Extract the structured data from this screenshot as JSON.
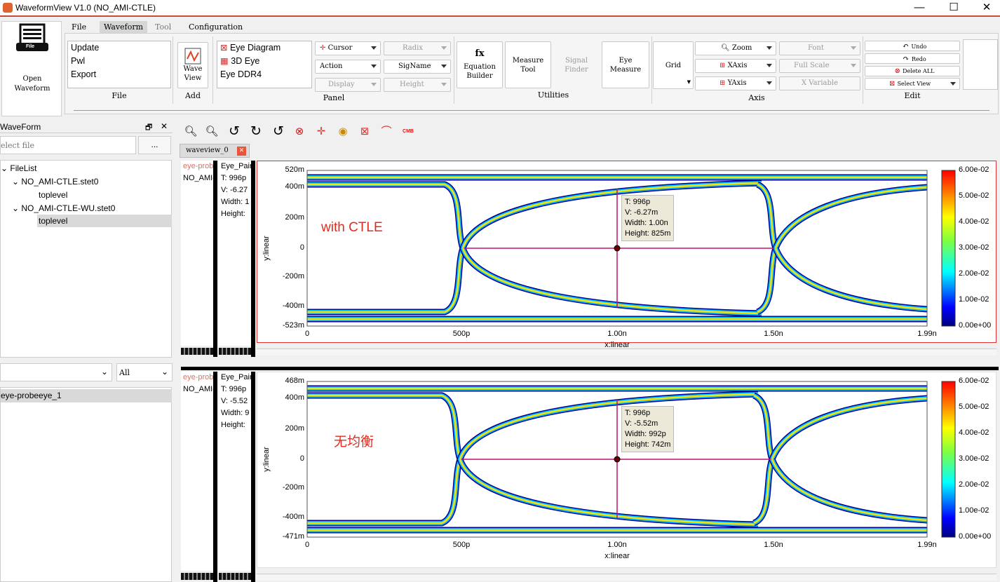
{
  "window": {
    "title": "WaveformView V1.0 (NO_AMI-CTLE)",
    "min": "—",
    "max": "☐",
    "close": "✕"
  },
  "menu": [
    "File",
    "Waveform",
    "Tool",
    "Configuration"
  ],
  "ribbon": {
    "open": {
      "icon_text": "File",
      "label1": "Open",
      "label2": "Waveform"
    },
    "file_list": [
      "Update",
      "Pwl",
      "Export"
    ],
    "file_group": "File",
    "wave_view": {
      "l1": "Wave",
      "l2": "View"
    },
    "add_group": "Add",
    "panel_list": [
      "Eye Diagram",
      "3D Eye",
      "Eye DDR4"
    ],
    "panel_group": "Panel",
    "combos": {
      "cursor": "Cursor",
      "action": "Action",
      "display": "Display",
      "radix": "Radix",
      "signame": "SigName",
      "height": "Height"
    },
    "eq": {
      "icon": "fx",
      "l1": "Equation",
      "l2": "Builder"
    },
    "measure": {
      "l1": "Measure",
      "l2": "Tool"
    },
    "signal": {
      "l1": "Signal",
      "l2": "Finder"
    },
    "eye": {
      "l1": "Eye",
      "l2": "Measure"
    },
    "util_group": "Utilities",
    "grid": "Grid",
    "zoom": "Zoom",
    "xaxis": "XAxis",
    "yaxis": "YAxis",
    "font": "Font",
    "fullscale": "Full Scale",
    "xvar": "X Variable",
    "axis_group": "Axis",
    "undo": "Undo",
    "redo": "Redo",
    "delall": "Delete ALL",
    "selview": "Select View",
    "edit_group": "Edit"
  },
  "left": {
    "title": "WaveForm",
    "float": "🗗",
    "close": "✕",
    "file_placeholder": "elect file",
    "browse": "...",
    "tree": [
      "FileList",
      "NO_AMI-CTLE.stet0",
      "toplevel",
      "NO_AMI-CTLE-WU.stet0",
      "toplevel"
    ],
    "filter_all": "All",
    "signal": "eye-probeeye_1"
  },
  "tab": "waveview_0",
  "plots": [
    {
      "sig": "eye-prob",
      "sig2": "NO_AMI-",
      "col2": [
        "Eye_Pair",
        "T: 996p",
        "V: -6.27",
        "Width: 1",
        "Height:"
      ],
      "yticks": [
        "520m",
        "400m",
        "200m",
        "0",
        "-200m",
        "-400m",
        "-523m"
      ],
      "xticks": [
        "0",
        "500p",
        "1.00n",
        "1.50n",
        "1.99n"
      ],
      "xlabel": "x:linear",
      "ylabel": "y:linear",
      "tip": [
        "T: 996p",
        "V: -6.27m",
        "Width: 1.00n",
        "Height: 825m"
      ],
      "annotation": "with CTLE",
      "cbar": [
        "6.00e-02",
        "5.00e-02",
        "4.00e-02",
        "3.00e-02",
        "2.00e-02",
        "1.00e-02",
        "0.00e+00"
      ]
    },
    {
      "sig": "eye-prob",
      "sig2": "NO_AMI-",
      "col2": [
        "Eye_Pair",
        "T: 996p",
        "V: -5.52",
        "Width: 9",
        "Height:"
      ],
      "yticks": [
        "468m",
        "400m",
        "200m",
        "0",
        "-200m",
        "-400m",
        "-471m"
      ],
      "xticks": [
        "0",
        "500p",
        "1.00n",
        "1.50n",
        "1.99n"
      ],
      "xlabel": "x:linear",
      "ylabel": "y:linear",
      "tip": [
        "T: 996p",
        "V: -5.52m",
        "Width: 992p",
        "Height: 742m"
      ],
      "annotation": "无均衡",
      "cbar": [
        "6.00e-02",
        "5.00e-02",
        "4.00e-02",
        "3.00e-02",
        "2.00e-02",
        "1.00e-02",
        "0.00e+00"
      ]
    }
  ]
}
